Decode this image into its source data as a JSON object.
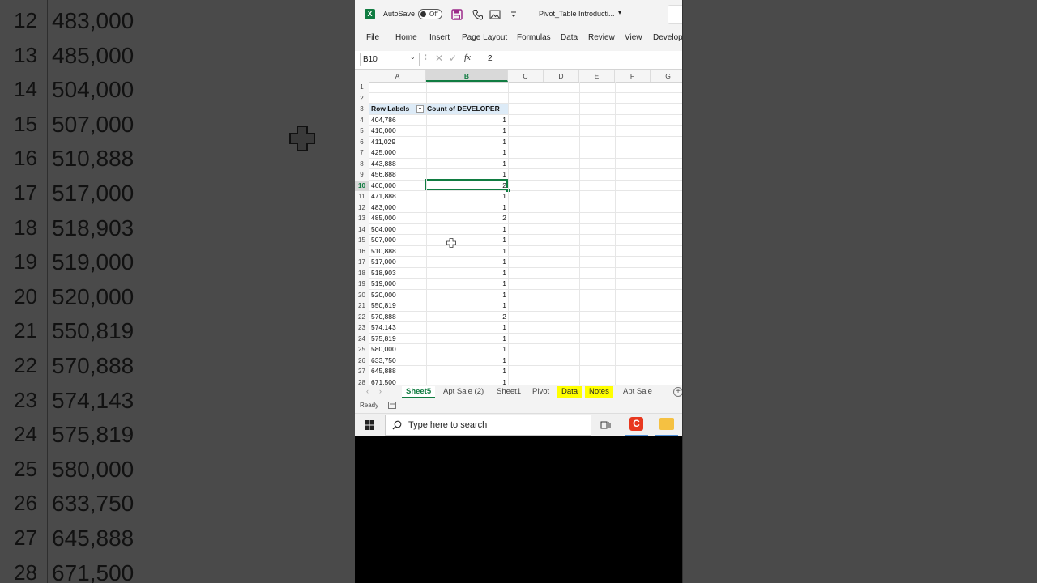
{
  "background": {
    "rows": [
      {
        "num": "12",
        "value": "483,000"
      },
      {
        "num": "13",
        "value": "485,000"
      },
      {
        "num": "14",
        "value": "504,000"
      },
      {
        "num": "15",
        "value": "507,000"
      },
      {
        "num": "16",
        "value": "510,888"
      },
      {
        "num": "17",
        "value": "517,000"
      },
      {
        "num": "18",
        "value": "518,903"
      },
      {
        "num": "19",
        "value": "519,000"
      },
      {
        "num": "20",
        "value": "520,000"
      },
      {
        "num": "21",
        "value": "550,819"
      },
      {
        "num": "22",
        "value": "570,888"
      },
      {
        "num": "23",
        "value": "574,143"
      },
      {
        "num": "24",
        "value": "575,819"
      },
      {
        "num": "25",
        "value": "580,000"
      },
      {
        "num": "26",
        "value": "633,750"
      },
      {
        "num": "27",
        "value": "645,888"
      },
      {
        "num": "28",
        "value": "671,500"
      }
    ]
  },
  "titlebar": {
    "autosave_label": "AutoSave",
    "autosave_state": "Off",
    "file_title": "Pivot_Table Introducti...",
    "caret": "▾"
  },
  "ribbon": {
    "tabs": [
      "File",
      "Home",
      "Insert",
      "Page Layout",
      "Formulas",
      "Data",
      "Review",
      "View",
      "Developer"
    ]
  },
  "formula_bar": {
    "name_box": "B10",
    "fx": "fx",
    "value": "2"
  },
  "grid": {
    "columns": [
      "A",
      "B",
      "C",
      "D",
      "E",
      "F",
      "G"
    ],
    "selected_column": "B",
    "selected_row": "10",
    "rows": [
      {
        "num": "1",
        "a": "",
        "b": ""
      },
      {
        "num": "2",
        "a": "",
        "b": ""
      },
      {
        "num": "3",
        "a": "Row Labels",
        "b": "Count of DEVELOPER",
        "header": true
      },
      {
        "num": "4",
        "a": "404,786",
        "b": "1"
      },
      {
        "num": "5",
        "a": "410,000",
        "b": "1"
      },
      {
        "num": "6",
        "a": "411,029",
        "b": "1"
      },
      {
        "num": "7",
        "a": "425,000",
        "b": "1"
      },
      {
        "num": "8",
        "a": "443,888",
        "b": "1"
      },
      {
        "num": "9",
        "a": "456,888",
        "b": "1"
      },
      {
        "num": "10",
        "a": "460,000",
        "b": "2"
      },
      {
        "num": "11",
        "a": "471,888",
        "b": "1"
      },
      {
        "num": "12",
        "a": "483,000",
        "b": "1"
      },
      {
        "num": "13",
        "a": "485,000",
        "b": "2"
      },
      {
        "num": "14",
        "a": "504,000",
        "b": "1"
      },
      {
        "num": "15",
        "a": "507,000",
        "b": "1"
      },
      {
        "num": "16",
        "a": "510,888",
        "b": "1"
      },
      {
        "num": "17",
        "a": "517,000",
        "b": "1"
      },
      {
        "num": "18",
        "a": "518,903",
        "b": "1"
      },
      {
        "num": "19",
        "a": "519,000",
        "b": "1"
      },
      {
        "num": "20",
        "a": "520,000",
        "b": "1"
      },
      {
        "num": "21",
        "a": "550,819",
        "b": "1"
      },
      {
        "num": "22",
        "a": "570,888",
        "b": "2"
      },
      {
        "num": "23",
        "a": "574,143",
        "b": "1"
      },
      {
        "num": "24",
        "a": "575,819",
        "b": "1"
      },
      {
        "num": "25",
        "a": "580,000",
        "b": "1"
      },
      {
        "num": "26",
        "a": "633,750",
        "b": "1"
      },
      {
        "num": "27",
        "a": "645,888",
        "b": "1"
      },
      {
        "num": "28",
        "a": "671,500",
        "b": "1"
      }
    ]
  },
  "sheets": {
    "tabs": [
      {
        "label": "Sheet5",
        "style": "active"
      },
      {
        "label": "Apt Sale (2)",
        "style": ""
      },
      {
        "label": "Sheet1",
        "style": ""
      },
      {
        "label": "Pivot",
        "style": ""
      },
      {
        "label": "Data",
        "style": "yellow"
      },
      {
        "label": "Notes",
        "style": "yellow"
      },
      {
        "label": "Apt Sale",
        "style": ""
      }
    ],
    "add_symbol": "+"
  },
  "status": {
    "text": "Ready"
  },
  "taskbar": {
    "search_placeholder": "Type here to search"
  },
  "colors": {
    "excel_green": "#107c41",
    "pivot_header_bg": "#ddebf7",
    "highlight_tab": "#ffff00"
  }
}
